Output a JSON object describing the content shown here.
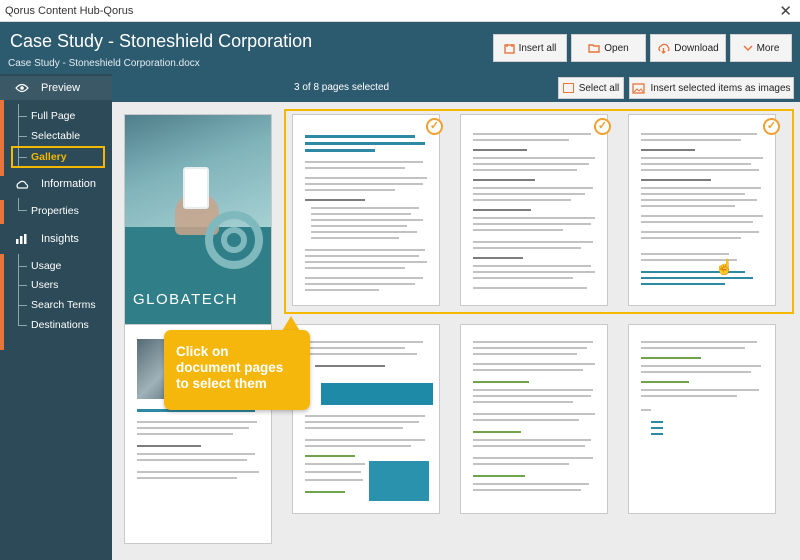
{
  "window": {
    "title": "Qorus Content Hub-Qorus",
    "close_glyph": "✕"
  },
  "header": {
    "title": "Case Study - Stoneshield Corporation",
    "filename": "Case Study - Stoneshield Corporation.docx",
    "buttons": [
      {
        "label": "Insert all",
        "icon": "insert-icon"
      },
      {
        "label": "Open",
        "icon": "folder-icon"
      },
      {
        "label": "Download",
        "icon": "download-icon"
      },
      {
        "label": "More",
        "icon": "chevron-down-icon"
      }
    ]
  },
  "sidebar": {
    "sections": [
      {
        "label": "Preview",
        "icon": "eye-icon",
        "items": [
          "Full Page",
          "Selectable",
          "Gallery"
        ]
      },
      {
        "label": "Information",
        "icon": "cloud-icon",
        "items": [
          "Properties"
        ]
      },
      {
        "label": "Insights",
        "icon": "chart-icon",
        "items": [
          "Usage",
          "Users",
          "Search Terms",
          "Destinations"
        ]
      }
    ],
    "selected_item": "Gallery"
  },
  "toolbar": {
    "selection_count": "3 of 8 pages selected",
    "select_all_label": "Select all",
    "insert_selected_label": "Insert selected items as images"
  },
  "gallery": {
    "cover_brand": "GLOBATECH",
    "selected_pages": 3,
    "total_pages": 8,
    "check_glyph": "✓"
  },
  "tooltip": {
    "text": "Click on\ndocument pages\nto select them"
  },
  "colors": {
    "header_bg": "#2c5b6f",
    "sidebar_bg": "#2c4a57",
    "accent_orange": "#e8743b",
    "selection_yellow": "#f5b800",
    "gallery_bg": "#ececec"
  }
}
